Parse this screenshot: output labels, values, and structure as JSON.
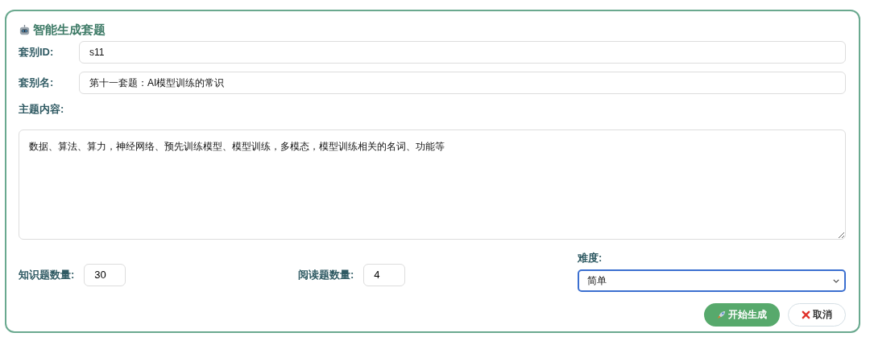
{
  "title": "智能生成套题",
  "fields": [
    {
      "label": "套别ID:",
      "value": "s11"
    },
    {
      "label": "套别名:",
      "value": "第十一套题：AI模型训练的常识"
    }
  ],
  "topic": {
    "label": "主题内容:",
    "value": "数据、算法、算力，神经网络、预先训练模型、模型训练，多模态，模型训练相关的名词、功能等"
  },
  "knowledge_count": {
    "label": "知识题数量:",
    "value": "30"
  },
  "reading_count": {
    "label": "阅读题数量:",
    "value": "4"
  },
  "difficulty": {
    "label": "难度:",
    "value": "简单"
  },
  "buttons": [
    {
      "kind": "primary",
      "label": "开始生成"
    },
    {
      "kind": "cancel",
      "label": "取消"
    }
  ]
}
